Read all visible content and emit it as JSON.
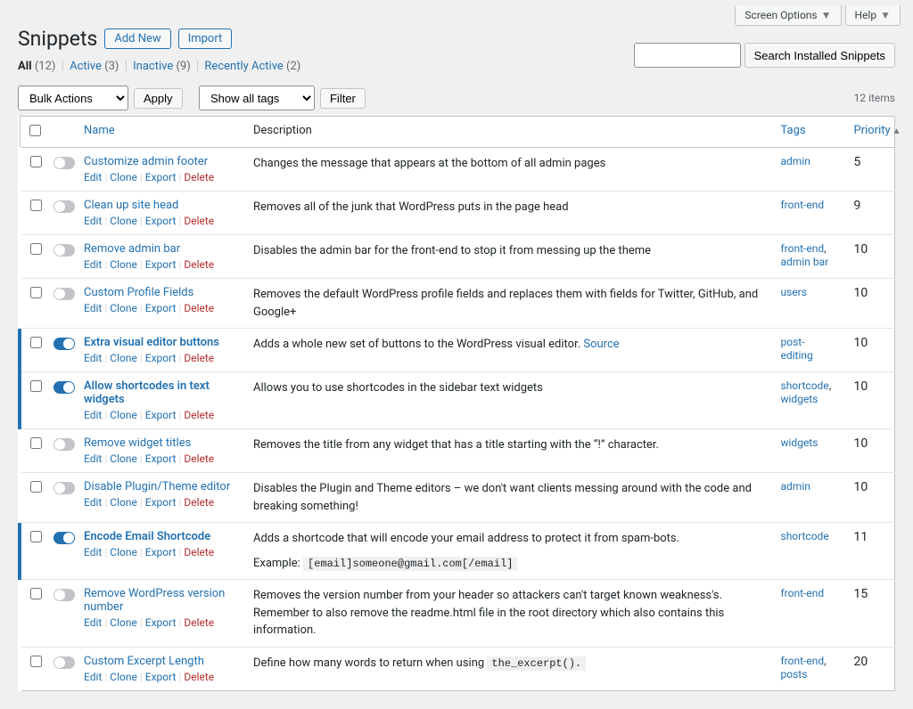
{
  "top_tabs": {
    "screen_options": "Screen Options",
    "help": "Help"
  },
  "header": {
    "title": "Snippets",
    "add_new": "Add New",
    "import": "Import"
  },
  "views": {
    "all": {
      "label": "All",
      "count": "(12)"
    },
    "active": {
      "label": "Active",
      "count": "(3)"
    },
    "inactive": {
      "label": "Inactive",
      "count": "(9)"
    },
    "recently_active": {
      "label": "Recently Active",
      "count": "(2)"
    }
  },
  "search": {
    "button": "Search Installed Snippets",
    "placeholder": ""
  },
  "bulk": {
    "actions": "Bulk Actions",
    "apply": "Apply",
    "tags": "Show all tags",
    "filter": "Filter"
  },
  "items_label": "12 items",
  "columns": {
    "name": "Name",
    "description": "Description",
    "tags": "Tags",
    "priority": "Priority"
  },
  "actions": {
    "edit": "Edit",
    "clone": "Clone",
    "export": "Export",
    "delete": "Delete"
  },
  "snippets": [
    {
      "title": "Customize admin footer",
      "active": false,
      "desc": "Changes the message that appears at the bottom of all admin pages",
      "tags": [
        "admin"
      ],
      "priority": "5"
    },
    {
      "title": "Clean up site head",
      "active": false,
      "desc": "Removes all of the junk that WordPress puts in the page head",
      "tags": [
        "front-end"
      ],
      "priority": "9"
    },
    {
      "title": "Remove admin bar",
      "active": false,
      "desc": "Disables the admin bar for the front-end to stop it from messing up the theme",
      "tags": [
        "front-end",
        "admin bar"
      ],
      "priority": "10"
    },
    {
      "title": "Custom Profile Fields",
      "active": false,
      "desc": "Removes the default WordPress profile fields and replaces them with fields for Twitter, GitHub, and Google+",
      "tags": [
        "users"
      ],
      "priority": "10"
    },
    {
      "title": "Extra visual editor buttons",
      "active": true,
      "desc": "Adds a whole new set of buttons to the WordPress visual editor. ",
      "source_link": "Source",
      "tags": [
        "post-editing"
      ],
      "priority": "10"
    },
    {
      "title": "Allow shortcodes in text widgets",
      "active": true,
      "desc": "Allows you to use shortcodes in the sidebar text widgets",
      "tags": [
        "shortcode",
        "widgets"
      ],
      "priority": "10"
    },
    {
      "title": "Remove widget titles",
      "active": false,
      "desc": "Removes the title from any widget that has a title starting with the “!” character.",
      "tags": [
        "widgets"
      ],
      "priority": "10"
    },
    {
      "title": "Disable Plugin/Theme editor",
      "active": false,
      "desc": "Disables the Plugin and Theme editors – we don't want clients messing around with the code and breaking something!",
      "tags": [
        "admin"
      ],
      "priority": "10"
    },
    {
      "title": "Encode Email Shortcode",
      "active": true,
      "desc_pre": "Adds a shortcode that will encode your email address to protect it from spam-bots.",
      "desc_line2_pre": "Example: ",
      "desc_line2_code": "[email]someone@gmail.com[/email]",
      "tags": [
        "shortcode"
      ],
      "priority": "11"
    },
    {
      "title": "Remove WordPress version number",
      "active": false,
      "desc": "Removes the version number from your header so attackers can't target known weakness's. Remember to also remove the readme.html file in the root directory which also contains this information.",
      "tags": [
        "front-end"
      ],
      "priority": "15"
    },
    {
      "title": "Custom Excerpt Length",
      "active": false,
      "desc_pre": "Define how many words to return when using ",
      "desc_code": "the_excerpt().",
      "tags": [
        "front-end",
        "posts"
      ],
      "priority": "20"
    }
  ]
}
